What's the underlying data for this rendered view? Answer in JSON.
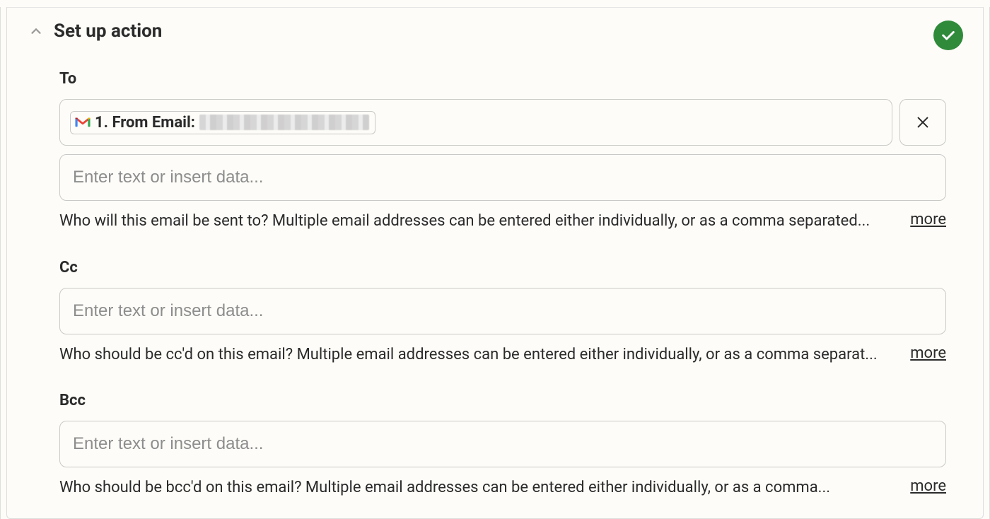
{
  "section": {
    "title": "Set up action",
    "completed": true
  },
  "fields": {
    "to": {
      "label": "To",
      "tag_source": "gmail",
      "tag_label": "1. From Email:",
      "tag_value_redacted": true,
      "extra_placeholder": "Enter text or insert data...",
      "help": "Who will this email be sent to? Multiple email addresses can be entered either individually, or as a comma separated...",
      "more": "more"
    },
    "cc": {
      "label": "Cc",
      "placeholder": "Enter text or insert data...",
      "help": "Who should be cc'd on this email? Multiple email addresses can be entered either individually, or as a comma separat...",
      "more": "more"
    },
    "bcc": {
      "label": "Bcc",
      "placeholder": "Enter text or insert data...",
      "help": "Who should be bcc'd on this email? Multiple email addresses can be entered either individually, or as a comma...",
      "more": "more"
    }
  }
}
